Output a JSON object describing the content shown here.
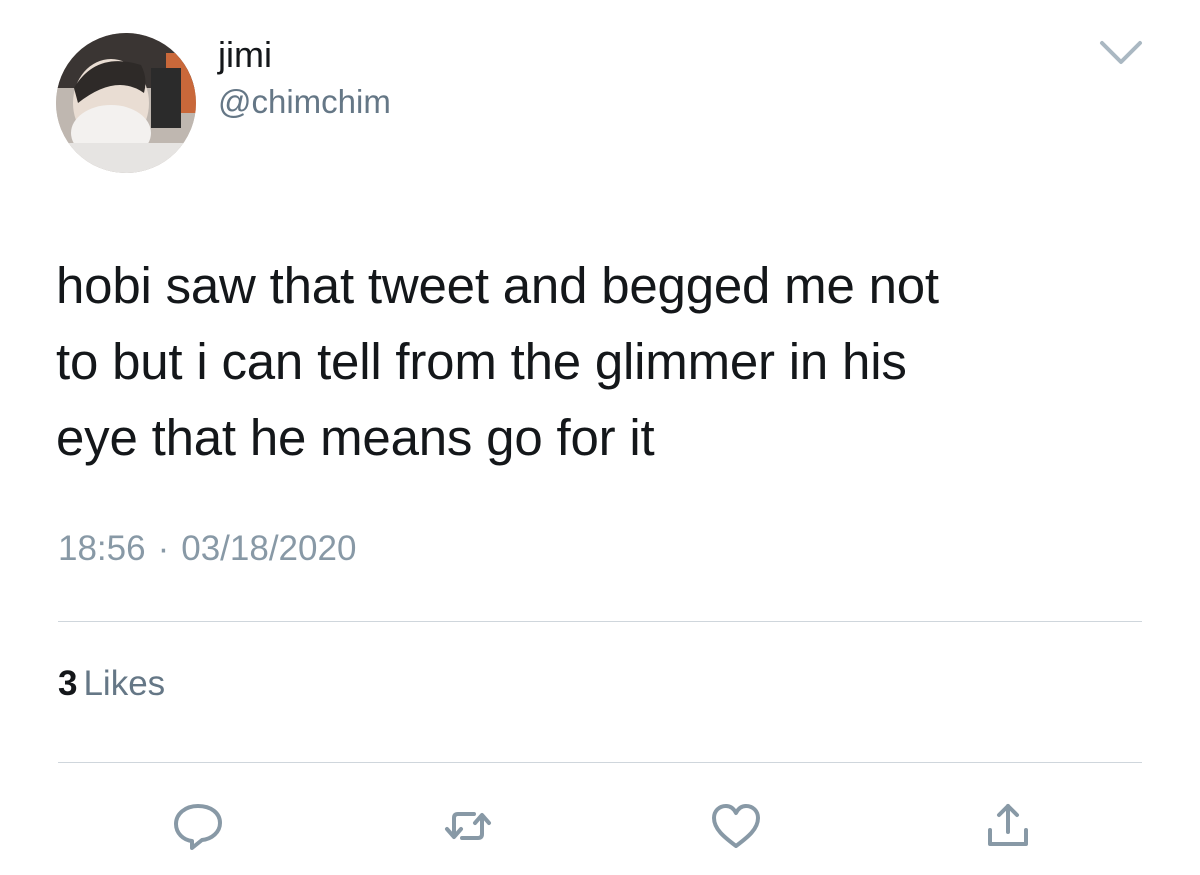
{
  "author": {
    "display_name": "jimi",
    "handle": "@chimchim",
    "avatar_alt": "profile photo"
  },
  "tweet": {
    "text_lines": [
      "hobi saw that tweet and begged me not",
      "to but i can tell from the glimmer in his",
      "eye that he means go for it"
    ],
    "time": "18:56",
    "separator": "·",
    "date": "03/18/2020"
  },
  "engagement": {
    "likes_count": "3",
    "likes_label": "Likes"
  },
  "actions": [
    {
      "name": "reply",
      "icon": "reply-icon"
    },
    {
      "name": "retweet",
      "icon": "retweet-icon"
    },
    {
      "name": "like",
      "icon": "heart-icon"
    },
    {
      "name": "share",
      "icon": "share-icon"
    }
  ],
  "colors": {
    "text_primary": "#14171a",
    "text_secondary": "#657786",
    "icon_gray": "#8899a6",
    "divider": "#cfd6dc"
  }
}
